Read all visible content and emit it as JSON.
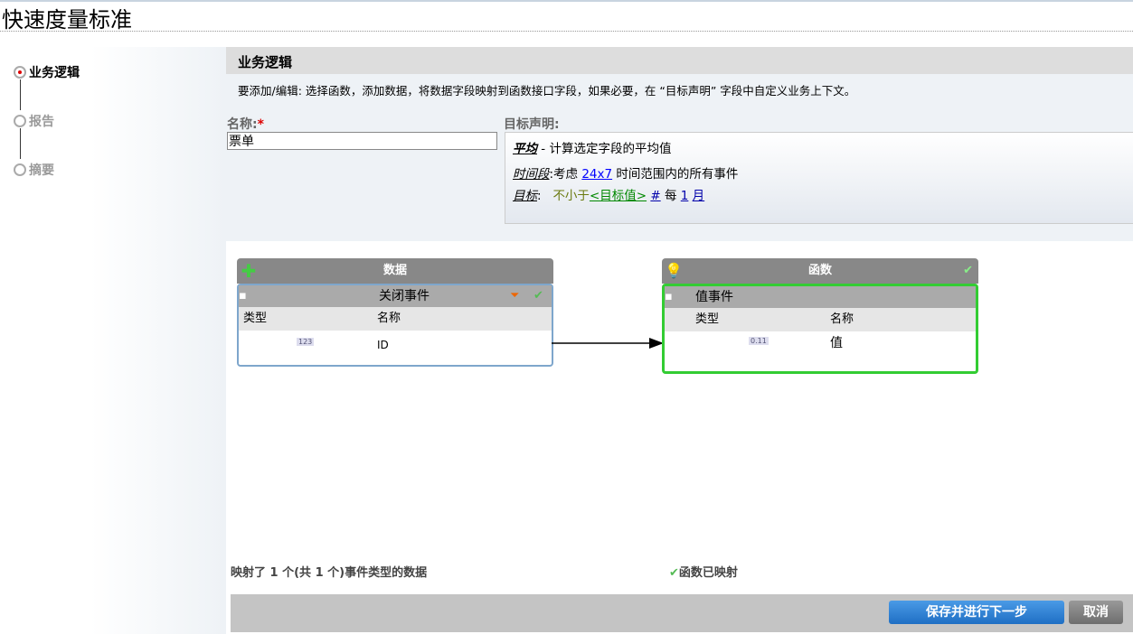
{
  "page_title": "快速度量标准",
  "steps": [
    {
      "label": "业务逻辑",
      "active": true
    },
    {
      "label": "报告",
      "active": false
    },
    {
      "label": "摘要",
      "active": false
    }
  ],
  "section": {
    "title": "业务逻辑",
    "instructions": "要添加/编辑: 选择函数，添加数据，将数据字段映射到函数接口字段，如果必要，在 “目标声明” 字段中自定义业务上下文。"
  },
  "name_field": {
    "label": "名称:",
    "required": "*",
    "value": "票单"
  },
  "goal": {
    "label": "目标声明:",
    "func_name": "平均",
    "func_desc": " - 计算选定字段的平均值",
    "period_label": "时间段",
    "period_pre": ":考虑 ",
    "period_link": "24x7",
    "period_post": " 时间范围内的所有事件",
    "target_label": "目标",
    "target_sep": ":",
    "target_cond": "不小于",
    "target_value": "<目标值>",
    "unit": "#",
    "per": " 每 ",
    "count": "1",
    "period": "月"
  },
  "data_box": {
    "title": "数据",
    "event": "关闭事件",
    "col_type": "类型",
    "col_name": "名称",
    "row_type": "123",
    "row_name": "ID"
  },
  "func_box": {
    "title": "函数",
    "event": "值事件",
    "col_type": "类型",
    "col_name": "名称",
    "row_type": "0.11",
    "row_name": "值"
  },
  "status": {
    "data_mapped": "映射了  1 个(共  1 个)事件类型的数据",
    "func_mapped": "函数已映射"
  },
  "buttons": {
    "save_next": "保存并进行下一步",
    "cancel": "取消"
  }
}
